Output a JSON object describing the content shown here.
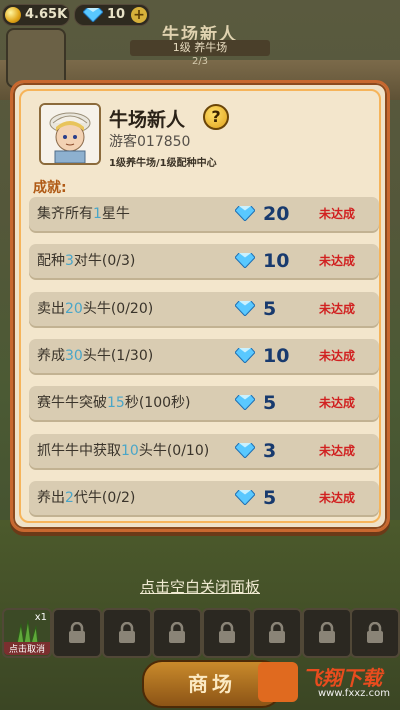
{
  "topbar": {
    "money": "4.65K",
    "gems": "10",
    "plus": "+"
  },
  "background": {
    "title": "牛场新人",
    "level": "1级 养牛场",
    "progress": "2/3"
  },
  "panel": {
    "name": "牛场新人",
    "help": "?",
    "guest": "游客017850",
    "level_info": "1级养牛场/1级配种中心",
    "achievements_title": "成就:",
    "achievements": [
      {
        "pre": "集齐所有",
        "num": "1",
        "post": "星牛",
        "reward": "20",
        "status": "未达成"
      },
      {
        "pre": "配种",
        "num": "3",
        "post": "对牛(0/3)",
        "reward": "10",
        "status": "未达成"
      },
      {
        "pre": "卖出",
        "num": "20",
        "post": "头牛(0/20)",
        "reward": "5",
        "status": "未达成"
      },
      {
        "pre": "养成",
        "num": "30",
        "post": "头牛(1/30)",
        "reward": "10",
        "status": "未达成"
      },
      {
        "pre": "赛牛牛突破",
        "num": "15",
        "post": "秒(100秒)",
        "reward": "5",
        "status": "未达成"
      },
      {
        "pre": "抓牛牛中获取",
        "num": "10",
        "post": "头牛(0/10)",
        "reward": "3",
        "status": "未达成"
      },
      {
        "pre": "养出",
        "num": "2",
        "post": "代牛(0/2)",
        "reward": "5",
        "status": "未达成"
      }
    ]
  },
  "close_hint": "点击空白关闭面板",
  "slots": {
    "count": "x1",
    "cancel": "点击取消"
  },
  "shop_button": "商场",
  "watermark": {
    "brand": "飞翔下载",
    "url": "www.fxxz.com"
  },
  "colors": {
    "panel_border": "#c8682f",
    "highlight": "#4aa6c8",
    "status": "#d12020"
  }
}
